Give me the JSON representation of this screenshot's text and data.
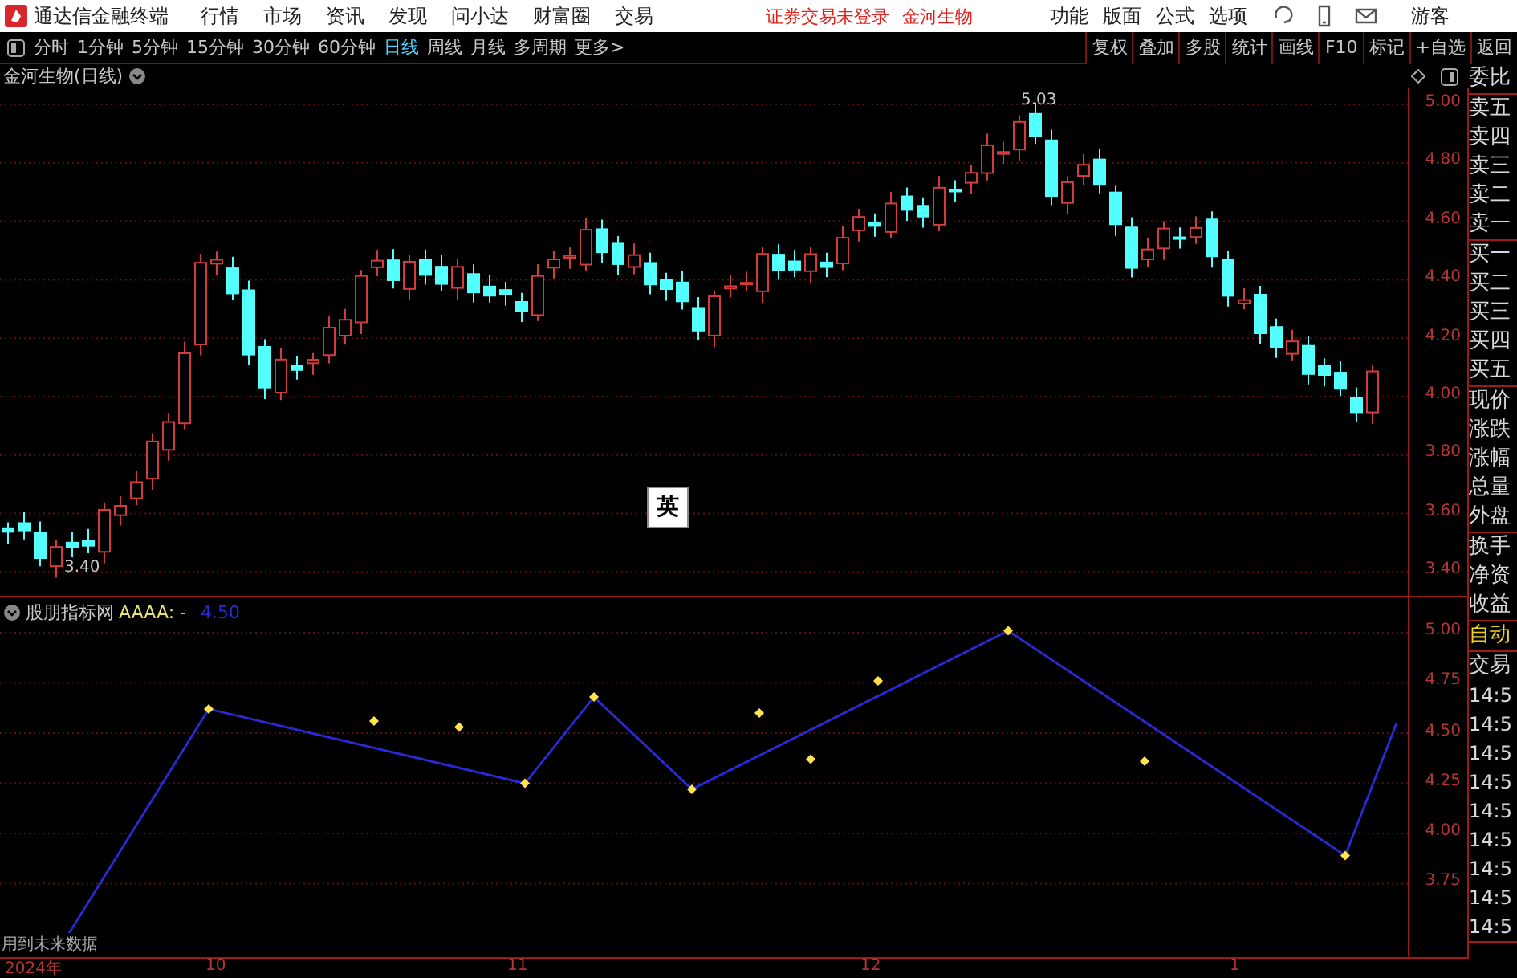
{
  "menubar": {
    "app_title": "通达信金融终端",
    "menus": [
      "行情",
      "市场",
      "资讯",
      "发现",
      "问小达",
      "财富圈",
      "交易"
    ],
    "notices": [
      "证券交易未登录",
      "金河生物"
    ],
    "right_menus": [
      "功能",
      "版面",
      "公式",
      "选项"
    ],
    "user": "游客"
  },
  "toolbar": {
    "periods": [
      {
        "label": "分时",
        "selected": false
      },
      {
        "label": "1分钟",
        "selected": false
      },
      {
        "label": "5分钟",
        "selected": false
      },
      {
        "label": "15分钟",
        "selected": false
      },
      {
        "label": "30分钟",
        "selected": false
      },
      {
        "label": "60分钟",
        "selected": false
      },
      {
        "label": "日线",
        "selected": true
      },
      {
        "label": "周线",
        "selected": false
      },
      {
        "label": "月线",
        "selected": false
      },
      {
        "label": "多周期",
        "selected": false
      },
      {
        "label": "更多>",
        "selected": false
      }
    ],
    "buttons": [
      "复权",
      "叠加",
      "多股",
      "统计",
      "画线",
      "F10",
      "标记",
      "+自选",
      "返回"
    ]
  },
  "price_chart": {
    "title": "金河生物(日线)",
    "high_marker": "5.03",
    "low_marker": "3.40",
    "y_ticks": [
      "5.00",
      "4.80",
      "4.60",
      "4.40",
      "4.20",
      "4.00",
      "3.80",
      "3.60",
      "3.40"
    ]
  },
  "ime_indicator": "英",
  "indicator_chart": {
    "name": "股朋指标网",
    "series_label": "AAAA: -",
    "value": "4.50",
    "y_ticks": [
      "5.00",
      "4.75",
      "4.50",
      "4.25",
      "4.00",
      "3.75"
    ],
    "warning": "用到未来数据"
  },
  "x_axis": [
    "2024年",
    "10",
    "11",
    "12",
    "1"
  ],
  "quote_panel": {
    "labels": [
      "委比",
      "卖五",
      "卖四",
      "卖三",
      "卖二",
      "卖一",
      "买一",
      "买二",
      "买三",
      "买四",
      "买五",
      "现价",
      "涨跌",
      "涨幅",
      "总量",
      "外盘",
      "换手",
      "净资",
      "收益"
    ],
    "mode": "自动",
    "trades_title": "交易",
    "trade_times": [
      "14:5",
      "14:5",
      "14:5",
      "14:5",
      "14:5",
      "14:5",
      "14:5",
      "14:5",
      "14:5"
    ]
  }
}
